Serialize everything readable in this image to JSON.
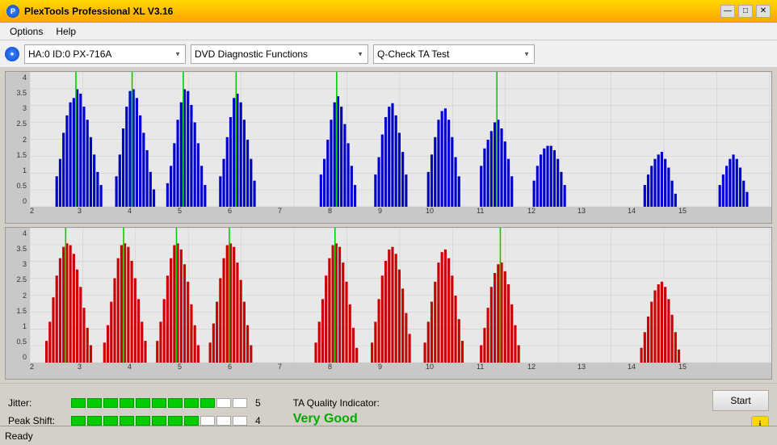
{
  "titleBar": {
    "title": "PlexTools Professional XL V3.16",
    "minBtn": "—",
    "maxBtn": "□",
    "closeBtn": "✕"
  },
  "menuBar": {
    "items": [
      "Options",
      "Help"
    ]
  },
  "toolbar": {
    "driveLabel": "HA:0 ID:0  PX-716A",
    "functionLabel": "DVD Diagnostic Functions",
    "testLabel": "Q-Check TA Test"
  },
  "charts": {
    "top": {
      "color": "blue",
      "yLabels": [
        "4",
        "3.5",
        "3",
        "2.5",
        "2",
        "1.5",
        "1",
        "0.5",
        "0"
      ],
      "xLabels": [
        "2",
        "3",
        "4",
        "5",
        "6",
        "7",
        "8",
        "9",
        "10",
        "11",
        "12",
        "13",
        "14",
        "15"
      ]
    },
    "bottom": {
      "color": "red",
      "yLabels": [
        "4",
        "3.5",
        "3",
        "2.5",
        "2",
        "1.5",
        "1",
        "0.5",
        "0"
      ],
      "xLabels": [
        "2",
        "3",
        "4",
        "5",
        "6",
        "7",
        "8",
        "9",
        "10",
        "11",
        "12",
        "13",
        "14",
        "15"
      ]
    }
  },
  "metrics": {
    "jitter": {
      "label": "Jitter:",
      "filledBars": 9,
      "totalBars": 11,
      "value": "5"
    },
    "peakShift": {
      "label": "Peak Shift:",
      "filledBars": 8,
      "totalBars": 11,
      "value": "4"
    },
    "taQuality": {
      "label": "TA Quality Indicator:",
      "value": "Very Good"
    }
  },
  "startButton": {
    "label": "Start"
  },
  "infoIcon": "i",
  "statusBar": {
    "text": "Ready"
  }
}
